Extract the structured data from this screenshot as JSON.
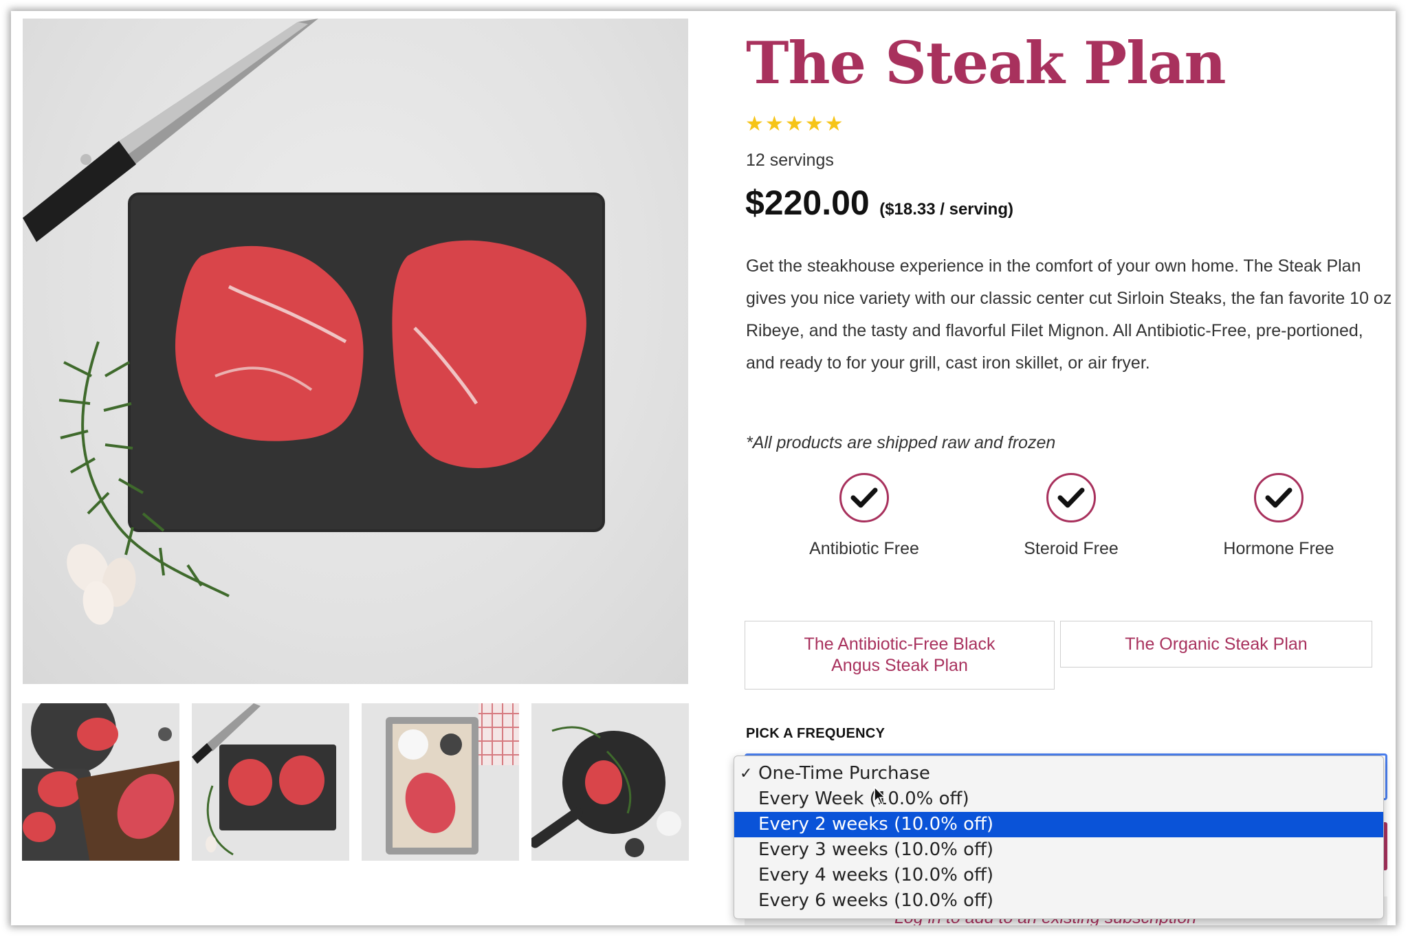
{
  "product": {
    "title": "The Steak Plan",
    "rating": 5,
    "stars": [
      "★",
      "★",
      "★",
      "★",
      "★"
    ],
    "servings": "12 servings",
    "price": "$220.00",
    "per_serving": "($18.33 / serving)",
    "description": "Get the steakhouse experience in the comfort of your own home. The Steak Plan gives you nice variety with our classic center cut Sirloin Steaks, the fan favorite 10 oz Ribeye, and the tasty and flavorful Filet Mignon. All Antibiotic-Free, pre-portioned, and ready to for your grill, cast iron skillet, or air fryer.",
    "shipping_note": "*All products are shipped raw and frozen"
  },
  "badges": [
    {
      "label": "Antibiotic Free",
      "icon": "check-icon"
    },
    {
      "label": "Steroid Free",
      "icon": "check-icon"
    },
    {
      "label": "Hormone Free",
      "icon": "check-icon"
    }
  ],
  "variants": [
    {
      "label": "The Antibiotic-Free Black Angus Steak Plan"
    },
    {
      "label": "The Organic Steak Plan"
    }
  ],
  "frequency": {
    "label": "PICK A FREQUENCY",
    "checked_option": "One-Time Purchase",
    "highlighted_option": "Every 2 weeks (10.0% off)",
    "options": [
      "One-Time Purchase",
      "Every Week (10.0% off)",
      "Every 2 weeks (10.0% off)",
      "Every 3 weeks (10.0% off)",
      "Every 4 weeks (10.0% off)",
      "Every 6 weeks (10.0% off)"
    ]
  },
  "subscription_link": "Log in to add to an existing subscription",
  "colors": {
    "brand": "#a8315d",
    "star": "#f6c417",
    "dropdown_highlight": "#0a53d8",
    "focus_ring": "#4a7ff0"
  }
}
